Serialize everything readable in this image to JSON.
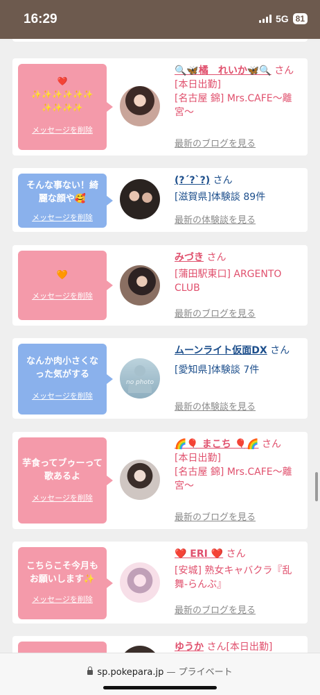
{
  "status_bar": {
    "time": "16:29",
    "network": "5G",
    "battery": "81"
  },
  "colors": {
    "pink": "#f49aaa",
    "blue": "#8ab1ec",
    "name_pink": "#e0506d",
    "name_blue": "#1d4f8c",
    "status_bg": "#6d5a4e"
  },
  "cards": [
    {
      "bubble_color": "pink",
      "message": "❤️\n✨✨✨✨✨✨\n✨✨✨✨",
      "delete_label": "メッセージを削除",
      "avatar_icon": "photo-woman-icon",
      "name": "🔍🦋橘　れいか🦋🔍",
      "honorific": "さん",
      "details": [
        "[本日出勤]",
        "[名古屋 錦] Mrs.CAFE〜離宮〜"
      ],
      "link": "最新のブログを見る"
    },
    {
      "bubble_color": "blue",
      "message": "そんな事ない！綺麗な顔や🥰",
      "delete_label": "メッセージを削除",
      "avatar_icon": "photo-couple-icon",
      "name": "(?´?`?)",
      "honorific": "さん",
      "details": [
        "[滋賀県]体験談 89件"
      ],
      "link": "最新の体験談を見る"
    },
    {
      "bubble_color": "pink",
      "message": "🧡",
      "delete_label": "メッセージを削除",
      "avatar_icon": "photo-woman-icon",
      "name": "みづき",
      "honorific": "さん",
      "details": [
        "[蒲田駅東口] ARGENTO CLUB"
      ],
      "link": "最新のブログを見る"
    },
    {
      "bubble_color": "blue",
      "message": "なんか肉小さくなった気がする",
      "delete_label": "メッセージを削除",
      "avatar_icon": "no-photo-icon",
      "avatar_text": "no photo",
      "name": "ムーンライト仮面DX",
      "honorific": "さん",
      "details": [
        "[愛知県]体験談 7件"
      ],
      "link": "最新の体験談を見る"
    },
    {
      "bubble_color": "pink",
      "message": "芋食ってブゥーって歌あるよ",
      "delete_label": "メッセージを削除",
      "avatar_icon": "photo-woman-icon",
      "name": "🌈🎈 まこち 🎈🌈",
      "honorific": "さん",
      "details": [
        "[本日出勤]",
        "[名古屋 錦] Mrs.CAFE〜離宮〜"
      ],
      "link": "最新のブログを見る"
    },
    {
      "bubble_color": "pink",
      "message": "こちらこそ今月もお願いします✨",
      "delete_label": "メッセージを削除",
      "avatar_icon": "photo-woman-icon",
      "name": "❤️ ERI ❤️",
      "honorific": "さん",
      "details": [
        "[安城] 熟女キャバクラ『乱舞-らんぶ』"
      ],
      "link": "最新のブログを見る"
    },
    {
      "bubble_color": "pink",
      "message": "",
      "delete_label": "",
      "avatar_icon": "photo-woman-icon",
      "name": "ゆうか",
      "honorific": "さん[本日出勤]",
      "details": [],
      "link": ""
    }
  ],
  "browser": {
    "url": "sp.pokepara.jp",
    "mode": "— プライベート"
  }
}
